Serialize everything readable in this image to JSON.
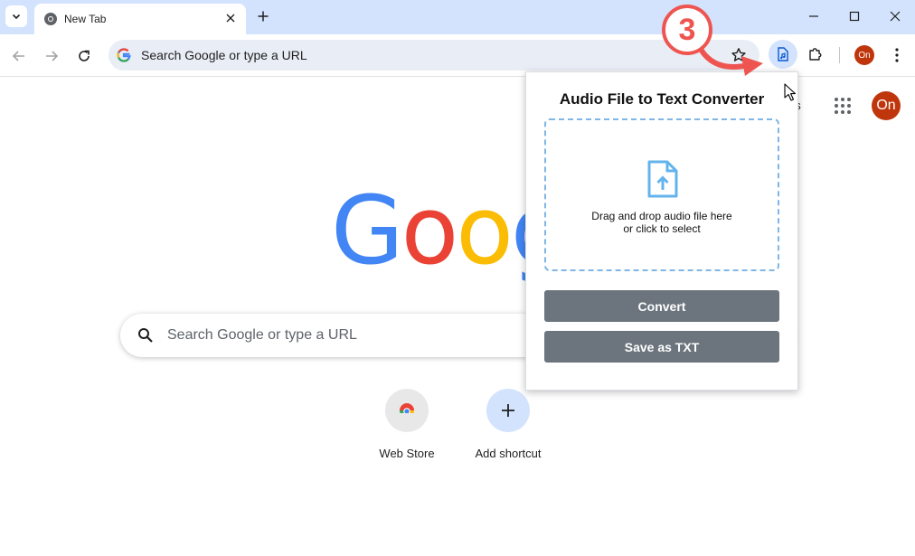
{
  "tab": {
    "title": "New Tab"
  },
  "omnibox": {
    "text": "Search Google or type a URL"
  },
  "profile": {
    "initials": "On"
  },
  "ntp": {
    "images_label_partial": "es",
    "logo": [
      "G",
      "o",
      "o",
      "g"
    ],
    "search_placeholder": "Search Google or type a URL",
    "shortcuts": [
      {
        "label": "Web Store"
      },
      {
        "label": "Add shortcut"
      }
    ]
  },
  "popup": {
    "title": "Audio File to Text Converter",
    "drop_line1": "Drag and drop audio file here",
    "drop_line2": "or click to select",
    "convert_label": "Convert",
    "save_label": "Save as TXT"
  },
  "annotation": {
    "step": "3"
  },
  "colors": {
    "tabstrip": "#d3e3fd",
    "accent_blue": "#0b57d0",
    "button_gray": "#6c757d",
    "annotation_red": "#ee5550",
    "avatar": "#c0360c"
  }
}
